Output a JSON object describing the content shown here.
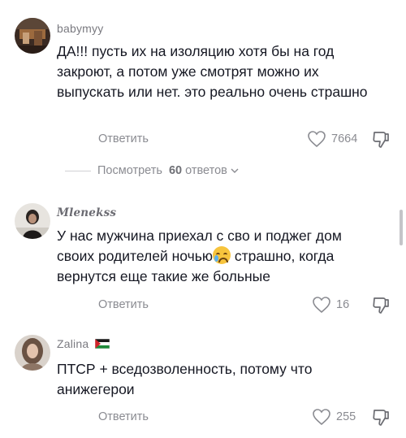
{
  "comments": [
    {
      "username": "babymyy",
      "text": "ДА!!! пусть их на изоляцию хотя бы на год закроют, а потом уже смотрят можно их выпускать или нет. это реально очень страшно",
      "reply_label": "Ответить",
      "likes": "7664"
    },
    {
      "username": "Mlenekss",
      "text_before_emoji": "У нас мужчина приехал с сво и поджег дом своих родителей ночью",
      "text_after_emoji": " страшно, когда вернутся еще такие же больные",
      "reply_label": "Ответить",
      "likes": "16"
    },
    {
      "username": "Zalina",
      "text": "ПТСР + вседозволенность, потому что анижегерои",
      "reply_label": "Ответить",
      "likes": "255"
    }
  ],
  "view_replies": {
    "prefix": "Посмотреть",
    "count": "60",
    "suffix": "ответов"
  },
  "icons": {
    "like": "heart-outline-icon",
    "dislike": "thumbs-down-icon",
    "expand": "chevron-down-icon",
    "emoji": "crying-face-emoji",
    "flag": "palestine-flag-icon"
  }
}
